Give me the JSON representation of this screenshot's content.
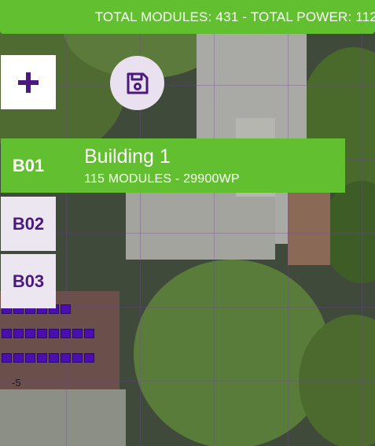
{
  "banner": {
    "text": "TOTAL MODULES: 431 - TOTAL POWER: 112.",
    "bg_color": "#62bf30"
  },
  "toolbar": {
    "add_icon": "plus-icon",
    "save_icon": "floppy-disk-icon"
  },
  "buildings": [
    {
      "code": "B01",
      "name": "Building 1",
      "stats": "115 MODULES - 29900WP",
      "selected": true
    },
    {
      "code": "B02",
      "selected": false
    },
    {
      "code": "B03",
      "selected": false
    }
  ],
  "map": {
    "label": "-5",
    "panel_color": "#4b0fb0",
    "accent_color": "#4b1a80"
  }
}
